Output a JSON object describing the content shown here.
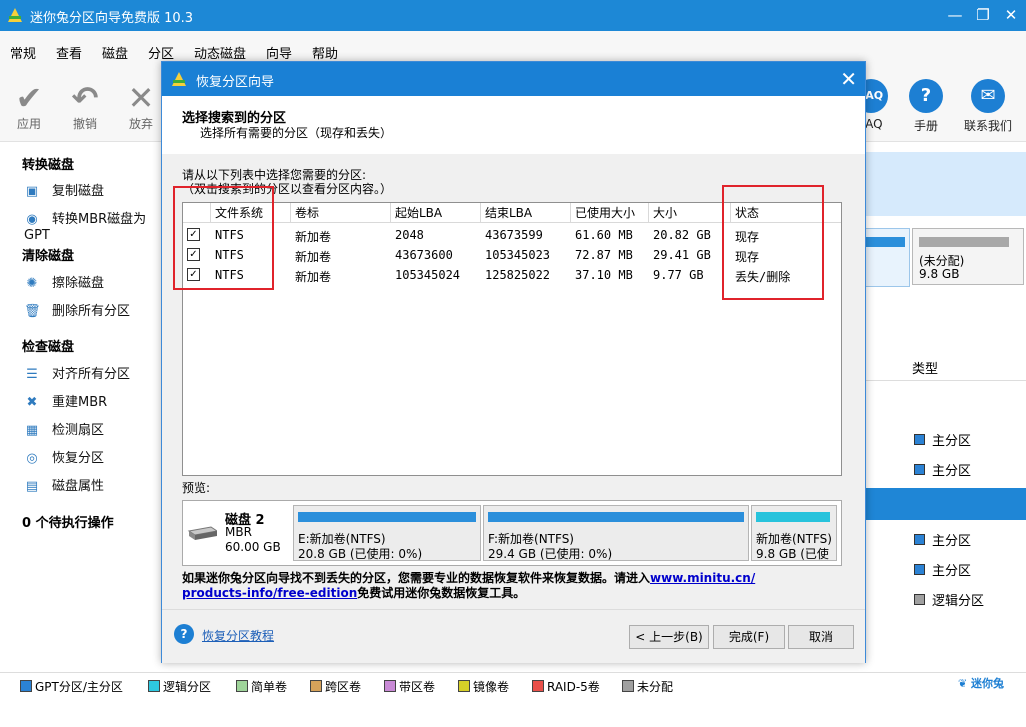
{
  "app": {
    "title": "迷你兔分区向导免费版 10.3"
  },
  "menu": [
    "常规",
    "查看",
    "磁盘",
    "分区",
    "动态磁盘",
    "向导",
    "帮助"
  ],
  "toolbar": {
    "left": [
      {
        "label": "应用",
        "icon": "check-icon"
      },
      {
        "label": "撤销",
        "icon": "undo-icon"
      },
      {
        "label": "放弃",
        "icon": "discard-icon"
      }
    ],
    "right": [
      {
        "label": "FAQ",
        "icon": "faq-icon",
        "glyph": "FAQ"
      },
      {
        "label": "手册",
        "icon": "help-icon",
        "glyph": "?"
      },
      {
        "label": "联系我们",
        "icon": "mail-icon",
        "glyph": "✉"
      }
    ]
  },
  "sidebar": {
    "groups": [
      {
        "title": "转换磁盘",
        "items": [
          "复制磁盘",
          "转换MBR磁盘为GPT"
        ]
      },
      {
        "title": "清除磁盘",
        "items": [
          "擦除磁盘",
          "删除所有分区"
        ]
      },
      {
        "title": "检查磁盘",
        "items": [
          "对齐所有分区",
          "重建MBR",
          "检测扇区",
          "恢复分区",
          "磁盘属性"
        ]
      }
    ],
    "pending": "0 个待执行操作"
  },
  "rightpane": {
    "unalloc_label": "(未分配)",
    "unalloc_size": "9.8 GB",
    "type_header": "类型",
    "types": [
      "主分区",
      "主分区",
      "主分区",
      "主分区",
      "逻辑分区"
    ]
  },
  "legend": [
    {
      "label": "GPT分区/主分区",
      "color": "#2b82d4"
    },
    {
      "label": "逻辑分区",
      "color": "#2ec8e0"
    },
    {
      "label": "简单卷",
      "color": "#9fd49a"
    },
    {
      "label": "跨区卷",
      "color": "#d6a25a"
    },
    {
      "label": "带区卷",
      "color": "#c98ad6"
    },
    {
      "label": "镜像卷",
      "color": "#d6cf28"
    },
    {
      "label": "RAID-5卷",
      "color": "#e8504a"
    },
    {
      "label": "未分配",
      "color": "#a0a0a0"
    }
  ],
  "brand": "迷你兔",
  "dialog": {
    "title": "恢复分区向导",
    "heading": "选择搜索到的分区",
    "subheading": "选择所有需要的分区（现存和丢失）",
    "instruction1": "请从以下列表中选择您需要的分区:",
    "instruction2": "（双击搜索到的分区以查看分区内容。）",
    "columns": [
      "文件系统",
      "卷标",
      "起始LBA",
      "结束LBA",
      "已使用大小",
      "大小",
      "状态"
    ],
    "rows": [
      {
        "checked": true,
        "fs": "NTFS",
        "label": "新加卷",
        "start": "2048",
        "end": "43673599",
        "used": "61.60 MB",
        "size": "20.82 GB",
        "status": "现存"
      },
      {
        "checked": true,
        "fs": "NTFS",
        "label": "新加卷",
        "start": "43673600",
        "end": "105345023",
        "used": "72.87 MB",
        "size": "29.41 GB",
        "status": "现存"
      },
      {
        "checked": true,
        "fs": "NTFS",
        "label": "新加卷",
        "start": "105345024",
        "end": "125825022",
        "used": "37.10 MB",
        "size": "9.77 GB",
        "status": "丢失/删除"
      }
    ],
    "preview_label": "预览:",
    "disk": {
      "name": "磁盘 2",
      "type": "MBR",
      "size": "60.00 GB"
    },
    "parts": [
      {
        "line1": "E:新加卷(NTFS)",
        "line2": "20.8 GB (已使用: 0%)",
        "color": "#2b8fdb"
      },
      {
        "line1": "F:新加卷(NTFS)",
        "line2": "29.4 GB (已使用: 0%)",
        "color": "#2b8fdb"
      },
      {
        "line1": "新加卷(NTFS)",
        "line2": "9.8 GB (已使",
        "color": "#27c3dc"
      }
    ],
    "note_prefix": "如果迷你兔分区向导找不到丢失的分区，您需要专业的数据恢复软件来恢复数据。请进入",
    "note_link1": "www.minitu.cn/",
    "note_link2": "products-info/free-edition",
    "note_suffix": "免费试用迷你兔数据恢复工具。",
    "tutorial": "恢复分区教程",
    "buttons": {
      "back": "< 上一步(B)",
      "finish": "完成(F)",
      "cancel": "取消"
    }
  }
}
